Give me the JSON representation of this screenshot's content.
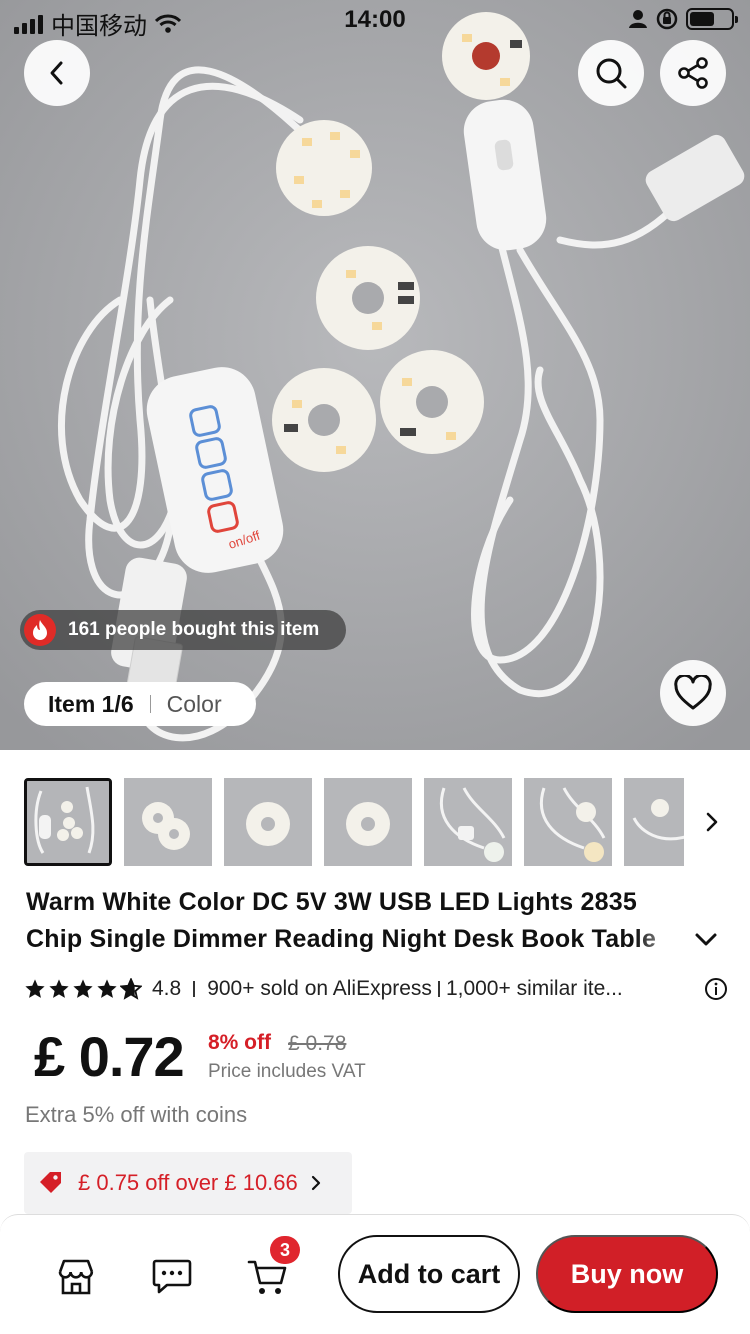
{
  "status_bar": {
    "carrier": "中国移动",
    "time": "14:00"
  },
  "hero": {
    "bought_text": "161 people bought this item",
    "item_counter": "Item 1/6",
    "variant_label": "Color",
    "device_text": "on/off",
    "background_color": "#a8a9ac"
  },
  "icons": {
    "back": "chevron-left-icon",
    "search": "search-icon",
    "share": "share-icon",
    "favorite": "heart-icon",
    "next_thumb": "chevron-right-icon",
    "expand_title": "chevron-down-icon",
    "info": "info-icon",
    "coupon": "tag-icon",
    "store": "store-icon",
    "chat": "chat-icon",
    "cart": "cart-icon"
  },
  "product": {
    "title_line1": "Warm White Color DC 5V 3W USB LED Lights 2835",
    "title_line2": "Chip Single Dimmer Reading Night Desk Book Table",
    "rating": "4.8",
    "rating_stars": 4.8,
    "sold": "900+ sold on AliExpress",
    "similar": "1,000+ similar ite...",
    "price": "£ 0.72",
    "discount": "8% off",
    "original_price": "£ 0.78",
    "vat_note": "Price includes VAT",
    "coins_note": "Extra 5% off with coins",
    "coupon_text": "£ 0.75 off over  £ 10.66"
  },
  "bottom_bar": {
    "cart_count": "3",
    "add_to_cart": "Add to cart",
    "buy_now": "Buy now"
  },
  "colors": {
    "accent_red": "#d11f27",
    "badge_red": "#e0262e",
    "text_dark": "#111111",
    "text_muted": "#777777"
  }
}
